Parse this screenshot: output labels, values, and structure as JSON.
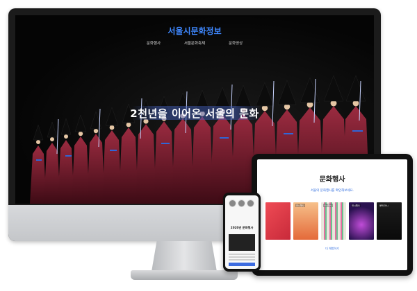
{
  "desktop_site": {
    "title": "서울시문화정보",
    "nav": [
      "문화행사",
      "서울문화축제",
      "문화영상"
    ],
    "hero_text": "2천년을 이어온 서울의 문화"
  },
  "tablet_site": {
    "title": "문화행사",
    "subtitle": "서울의 문화행사를 확인해보세요.",
    "posters": [
      {
        "tag": "",
        "color": "#e8454f"
      },
      {
        "tag": "전시행사",
        "color": "#f0a05a"
      },
      {
        "tag": "전시행사",
        "color": "#e9e6dc"
      },
      {
        "tag": "전시행사",
        "color": "#5a2e8a"
      },
      {
        "tag": "문화 전시",
        "color": "#161616"
      }
    ],
    "more_link": "더 체험하기"
  },
  "phone_site": {
    "title": "2020년 문화행사"
  },
  "colors": {
    "accent": "#3f88ff",
    "robe": "#7d1d30",
    "background": "#ffffff"
  }
}
